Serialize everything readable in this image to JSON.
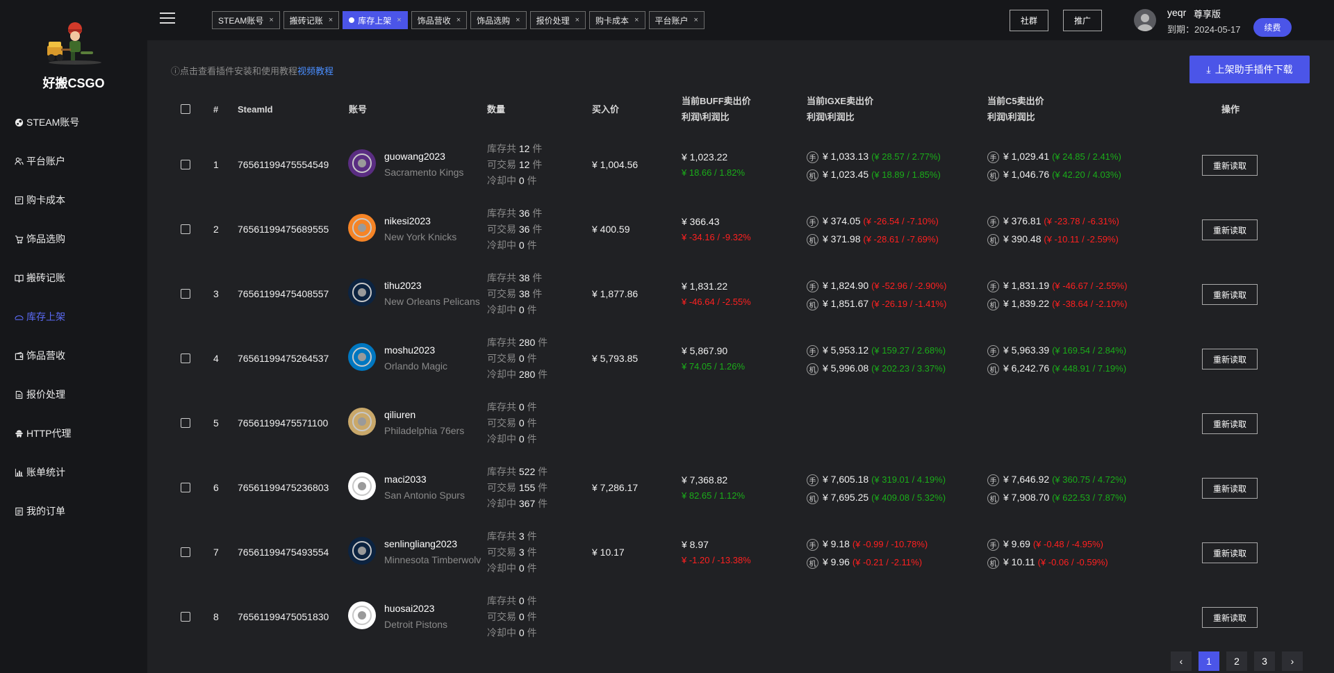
{
  "sidebar": {
    "brand": "好搬CSGO",
    "items": [
      {
        "label": "STEAM账号",
        "icon": "steam-icon"
      },
      {
        "label": "平台账户",
        "icon": "users-icon"
      },
      {
        "label": "购卡成本",
        "icon": "card-icon"
      },
      {
        "label": "饰品选购",
        "icon": "cart-icon"
      },
      {
        "label": "搬砖记账",
        "icon": "book-icon"
      },
      {
        "label": "库存上架",
        "icon": "shelf-icon",
        "active": true
      },
      {
        "label": "饰品营收",
        "icon": "wallet-icon"
      },
      {
        "label": "报价处理",
        "icon": "document-icon"
      },
      {
        "label": "HTTP代理",
        "icon": "proxy-icon"
      },
      {
        "label": "账单统计",
        "icon": "bar-chart-icon"
      },
      {
        "label": "我的订单",
        "icon": "order-icon"
      }
    ]
  },
  "tabs": [
    {
      "label": "STEAM账号"
    },
    {
      "label": "搬砖记账"
    },
    {
      "label": "库存上架",
      "active": true
    },
    {
      "label": "饰品营收"
    },
    {
      "label": "饰品选购"
    },
    {
      "label": "报价处理"
    },
    {
      "label": "购卡成本"
    },
    {
      "label": "平台账户"
    }
  ],
  "header": {
    "group_btn": "社群",
    "promo_btn": "推广",
    "user_name": "yeqr",
    "user_level": "尊享版",
    "expire": "到期：2024-05-17",
    "renew": "续费"
  },
  "info": {
    "text": "点击查看插件安装和使用教程",
    "link": "视频教程"
  },
  "download_btn": "上架助手插件下载",
  "columns": {
    "index": "#",
    "steamid": "SteamId",
    "account": "账号",
    "qty": "数量",
    "buy": "买入价",
    "buff_1": "当前BUFF卖出价",
    "buff_2": "利润\\利润比",
    "igxe_1": "当前IGXE卖出价",
    "igxe_2": "利润\\利润比",
    "c5_1": "当前C5卖出价",
    "c5_2": "利润\\利润比",
    "op": "操作"
  },
  "labels": {
    "stock": "库存共",
    "tradable": "可交易",
    "cooling": "冷却中",
    "unit": "件",
    "manual_mark": "手",
    "auto_mark": "机",
    "reload": "重新读取"
  },
  "rows": [
    {
      "index": "1",
      "steamid": "76561199475554549",
      "name": "guowang2023",
      "team": "Sacramento Kings",
      "stock": "12",
      "tradable": "12",
      "cooling": "0",
      "buy": "¥ 1,004.56",
      "buff": "¥ 1,023.22",
      "buff_p": "¥ 18.66 / 1.82%",
      "buff_s": "pos",
      "igxe_m": "¥ 1,033.13",
      "igxe_mp": "(¥ 28.57 / 2.77%)",
      "igxe_ms": "pos",
      "igxe_a": "¥ 1,023.45",
      "igxe_ap": "(¥ 18.89 / 1.85%)",
      "igxe_as": "pos",
      "c5_m": "¥ 1,029.41",
      "c5_mp": "(¥ 24.85 / 2.41%)",
      "c5_ms": "pos",
      "c5_a": "¥ 1,046.76",
      "c5_ap": "(¥ 42.20 / 4.03%)",
      "c5_as": "pos",
      "logo_color": "#5a2d82"
    },
    {
      "index": "2",
      "steamid": "76561199475689555",
      "name": "nikesi2023",
      "team": "New York Knicks",
      "stock": "36",
      "tradable": "36",
      "cooling": "0",
      "buy": "¥ 400.59",
      "buff": "¥ 366.43",
      "buff_p": "¥ -34.16 / -9.32%",
      "buff_s": "neg",
      "igxe_m": "¥ 374.05",
      "igxe_mp": "(¥ -26.54 / -7.10%)",
      "igxe_ms": "neg",
      "igxe_a": "¥ 371.98",
      "igxe_ap": "(¥ -28.61 / -7.69%)",
      "igxe_as": "neg",
      "c5_m": "¥ 376.81",
      "c5_mp": "(¥ -23.78 / -6.31%)",
      "c5_ms": "neg",
      "c5_a": "¥ 390.48",
      "c5_ap": "(¥ -10.11 / -2.59%)",
      "c5_as": "neg",
      "logo_color": "#f58426"
    },
    {
      "index": "3",
      "steamid": "76561199475408557",
      "name": "tihu2023",
      "team": "New Orleans Pelicans",
      "stock": "38",
      "tradable": "38",
      "cooling": "0",
      "buy": "¥ 1,877.86",
      "buff": "¥ 1,831.22",
      "buff_p": "¥ -46.64 / -2.55%",
      "buff_s": "neg",
      "igxe_m": "¥ 1,824.90",
      "igxe_mp": "(¥ -52.96 / -2.90%)",
      "igxe_ms": "neg",
      "igxe_a": "¥ 1,851.67",
      "igxe_ap": "(¥ -26.19 / -1.41%)",
      "igxe_as": "neg",
      "c5_m": "¥ 1,831.19",
      "c5_mp": "(¥ -46.67 / -2.55%)",
      "c5_ms": "neg",
      "c5_a": "¥ 1,839.22",
      "c5_ap": "(¥ -38.64 / -2.10%)",
      "c5_as": "neg",
      "logo_color": "#0c2340"
    },
    {
      "index": "4",
      "steamid": "76561199475264537",
      "name": "moshu2023",
      "team": "Orlando Magic",
      "stock": "280",
      "tradable": "0",
      "cooling": "280",
      "buy": "¥ 5,793.85",
      "buff": "¥ 5,867.90",
      "buff_p": "¥ 74.05 / 1.26%",
      "buff_s": "pos",
      "igxe_m": "¥ 5,953.12",
      "igxe_mp": "(¥ 159.27 / 2.68%)",
      "igxe_ms": "pos",
      "igxe_a": "¥ 5,996.08",
      "igxe_ap": "(¥ 202.23 / 3.37%)",
      "igxe_as": "pos",
      "c5_m": "¥ 5,963.39",
      "c5_mp": "(¥ 169.54 / 2.84%)",
      "c5_ms": "pos",
      "c5_a": "¥ 6,242.76",
      "c5_ap": "(¥ 448.91 / 7.19%)",
      "c5_as": "pos",
      "logo_color": "#0077c0"
    },
    {
      "index": "5",
      "steamid": "76561199475571100",
      "name": "qiliuren",
      "team": "Philadelphia 76ers",
      "stock": "0",
      "tradable": "0",
      "cooling": "0",
      "buy": "",
      "buff": "",
      "buff_p": "",
      "buff_s": "pos",
      "igxe_m": "",
      "igxe_mp": "",
      "igxe_ms": "pos",
      "igxe_a": "",
      "igxe_ap": "",
      "igxe_as": "pos",
      "c5_m": "",
      "c5_mp": "",
      "c5_ms": "pos",
      "c5_a": "",
      "c5_ap": "",
      "c5_as": "pos",
      "logo_color": "#c9a86a"
    },
    {
      "index": "6",
      "steamid": "76561199475236803",
      "name": "maci2033",
      "team": "San Antonio Spurs",
      "stock": "522",
      "tradable": "155",
      "cooling": "367",
      "buy": "¥ 7,286.17",
      "buff": "¥ 7,368.82",
      "buff_p": "¥ 82.65 / 1.12%",
      "buff_s": "pos",
      "igxe_m": "¥ 7,605.18",
      "igxe_mp": "(¥ 319.01 / 4.19%)",
      "igxe_ms": "pos",
      "igxe_a": "¥ 7,695.25",
      "igxe_ap": "(¥ 409.08 / 5.32%)",
      "igxe_as": "pos",
      "c5_m": "¥ 7,646.92",
      "c5_mp": "(¥ 360.75 / 4.72%)",
      "c5_ms": "pos",
      "c5_a": "¥ 7,908.70",
      "c5_ap": "(¥ 622.53 / 7.87%)",
      "c5_as": "pos",
      "logo_color": "#ffffff"
    },
    {
      "index": "7",
      "steamid": "76561199475493554",
      "name": "senlingliang2023",
      "team": "Minnesota Timberwolves",
      "stock": "3",
      "tradable": "3",
      "cooling": "0",
      "buy": "¥ 10.17",
      "buff": "¥ 8.97",
      "buff_p": "¥ -1.20 / -13.38%",
      "buff_s": "neg",
      "igxe_m": "¥ 9.18",
      "igxe_mp": "(¥ -0.99 / -10.78%)",
      "igxe_ms": "neg",
      "igxe_a": "¥ 9.96",
      "igxe_ap": "(¥ -0.21 / -2.11%)",
      "igxe_as": "neg",
      "c5_m": "¥ 9.69",
      "c5_mp": "(¥ -0.48 / -4.95%)",
      "c5_ms": "neg",
      "c5_a": "¥ 10.11",
      "c5_ap": "(¥ -0.06 / -0.59%)",
      "c5_as": "neg",
      "logo_color": "#0c2340"
    },
    {
      "index": "8",
      "steamid": "76561199475051830",
      "name": "huosai2023",
      "team": "Detroit Pistons",
      "stock": "0",
      "tradable": "0",
      "cooling": "0",
      "buy": "",
      "buff": "",
      "buff_p": "",
      "buff_s": "pos",
      "igxe_m": "",
      "igxe_mp": "",
      "igxe_ms": "pos",
      "igxe_a": "",
      "igxe_ap": "",
      "igxe_as": "pos",
      "c5_m": "",
      "c5_mp": "",
      "c5_ms": "pos",
      "c5_a": "",
      "c5_ap": "",
      "c5_as": "pos",
      "logo_color": "#ffffff"
    }
  ],
  "pagination": {
    "pages": [
      "1",
      "2",
      "3"
    ],
    "current": "1"
  },
  "colors": {
    "accent": "#4b55e8",
    "positive": "#1aad19",
    "negative": "#ff2020"
  }
}
